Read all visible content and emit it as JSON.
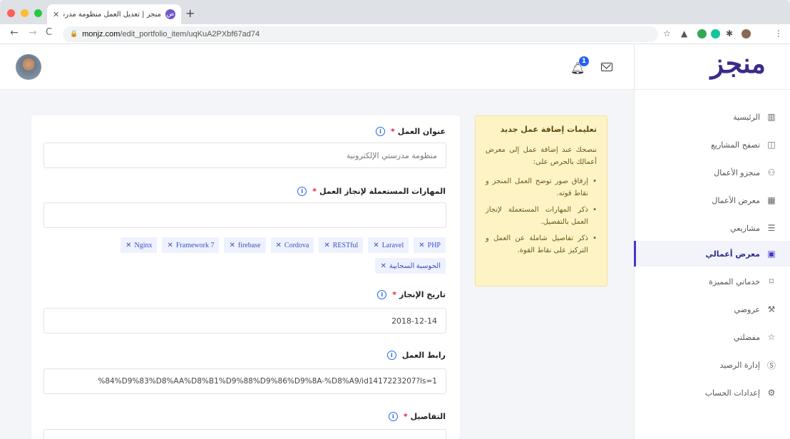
{
  "browser": {
    "tab_title": "منجز | تعديل العمل منظومة مدرستي...",
    "tab_favicon": "ص",
    "new_tab": "+",
    "url_domain": "monjz.com",
    "url_path": "/edit_portfolio_item/uqKuA2PXbf67ad74",
    "traffic_lights": [
      "#ff5f57",
      "#febc2e",
      "#28c840"
    ]
  },
  "header": {
    "logo_text": "منجز",
    "notification_count": "1"
  },
  "sidebar": {
    "items": [
      {
        "label": "الرئيسية",
        "icon": "chart-icon",
        "glyph": "📊"
      },
      {
        "label": "تصفح المشاريع",
        "icon": "briefcase-icon",
        "glyph": "🗂"
      },
      {
        "label": "منجزو الأعمال",
        "icon": "users-icon",
        "glyph": "👥"
      },
      {
        "label": "معرض الأعمال",
        "icon": "grid-icon",
        "glyph": "▦"
      },
      {
        "label": "مشاريعي",
        "icon": "list-icon",
        "glyph": "☰"
      },
      {
        "label": "معرض أعمالي",
        "icon": "gallery-icon",
        "glyph": "▣"
      },
      {
        "label": "خدماتي المميزة",
        "icon": "bookmark-icon",
        "glyph": "🔖"
      },
      {
        "label": "عروضي",
        "icon": "gavel-icon",
        "glyph": "⚒"
      },
      {
        "label": "مفضلتي",
        "icon": "star-icon",
        "glyph": "☆"
      },
      {
        "label": "إدارة الرصيد",
        "icon": "dollar-icon",
        "glyph": "$"
      },
      {
        "label": "إعدادات الحساب",
        "icon": "gear-icon",
        "glyph": "⚙"
      }
    ],
    "active_index": 5
  },
  "tips": {
    "title": "تعليمات إضافة عمل جديد",
    "intro": "ننصحك عند إضافة عمل إلى معرض أعمالك بالحرص على:",
    "items": [
      "إرفاق صور توضح العمل المنجز و نقاط قوته.",
      "ذكر المهارات المستعملة لإنجاز العمل بالتفصيل.",
      "ذكر تفاصيل شاملة عن العمل و التركيز على نقاط القوة."
    ]
  },
  "form": {
    "title_label": "عنوان العمل",
    "title_placeholder": "منظومة مدرستي الإلكترونية",
    "skills_label": "المهارات المستعملة لإنجاز العمل",
    "skills": [
      "PHP",
      "Laravel",
      "RESTful",
      "Cordova",
      "firebase",
      "Framework 7",
      "Nginx",
      "الحوسبة السحابية"
    ],
    "date_label": "تاريخ الإنجاز",
    "date_value": "2018-12-14",
    "link_label": "رابط العمل",
    "link_value": "%84%D9%83%D8%AA%D8%B1%D9%88%D9%86%D9%8A-%D8%A9/id1417223207?ls=1",
    "details_label": "التفاصيل",
    "required_mark": "*",
    "info_glyph": "i"
  }
}
